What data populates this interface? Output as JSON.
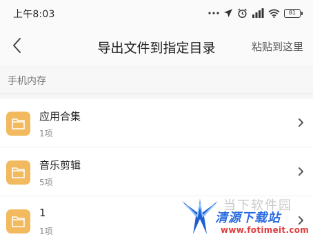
{
  "status_bar": {
    "time": "上午8:03",
    "battery": "81",
    "icons": [
      "dots-icon",
      "location-icon",
      "alarm-icon",
      "signal-icon",
      "wifi-icon",
      "battery-icon"
    ]
  },
  "header": {
    "title": "导出文件到指定目录",
    "paste_label": "粘贴到这里",
    "back_icon": "chevron-left-icon"
  },
  "breadcrumb": "手机内存",
  "folders": [
    {
      "name": "应用合集",
      "count": "1项"
    },
    {
      "name": "音乐剪辑",
      "count": "5项"
    },
    {
      "name": "1",
      "count": "1项"
    }
  ],
  "colors": {
    "folder": "#f3b95e",
    "background": "#ffffff",
    "header_bg": "#fafafa",
    "watermark_blue": "#2b6ce0",
    "watermark_red": "#e03c3c"
  },
  "watermark": {
    "line1": "当下软件园",
    "line2": "清源下载站",
    "url": "www.fotimeit.com"
  }
}
